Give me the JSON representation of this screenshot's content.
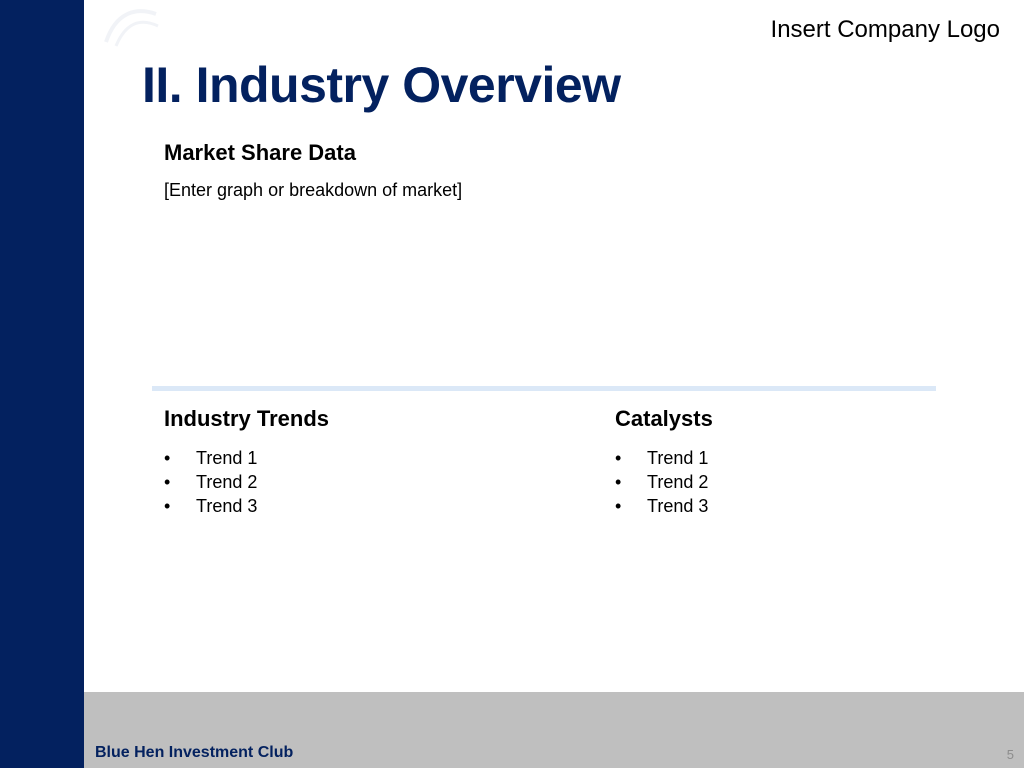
{
  "header": {
    "logo_placeholder": "Insert Company Logo",
    "title": "II. Industry Overview"
  },
  "market_share": {
    "heading": "Market Share Data",
    "placeholder": "[Enter graph or breakdown of market]"
  },
  "industry_trends": {
    "heading": "Industry Trends",
    "bullet": "•",
    "items": [
      "Trend 1",
      "Trend 2",
      "Trend 3"
    ]
  },
  "catalysts": {
    "heading": "Catalysts",
    "bullet": "•",
    "items": [
      "Trend 1",
      "Trend 2",
      "Trend 3"
    ]
  },
  "footer": {
    "club_name": "Blue Hen Investment Club",
    "page_number": "5"
  },
  "colors": {
    "brand_navy": "#03215f",
    "footer_gray": "#bfbfbf",
    "divider_blue": "#dbe8f7"
  }
}
